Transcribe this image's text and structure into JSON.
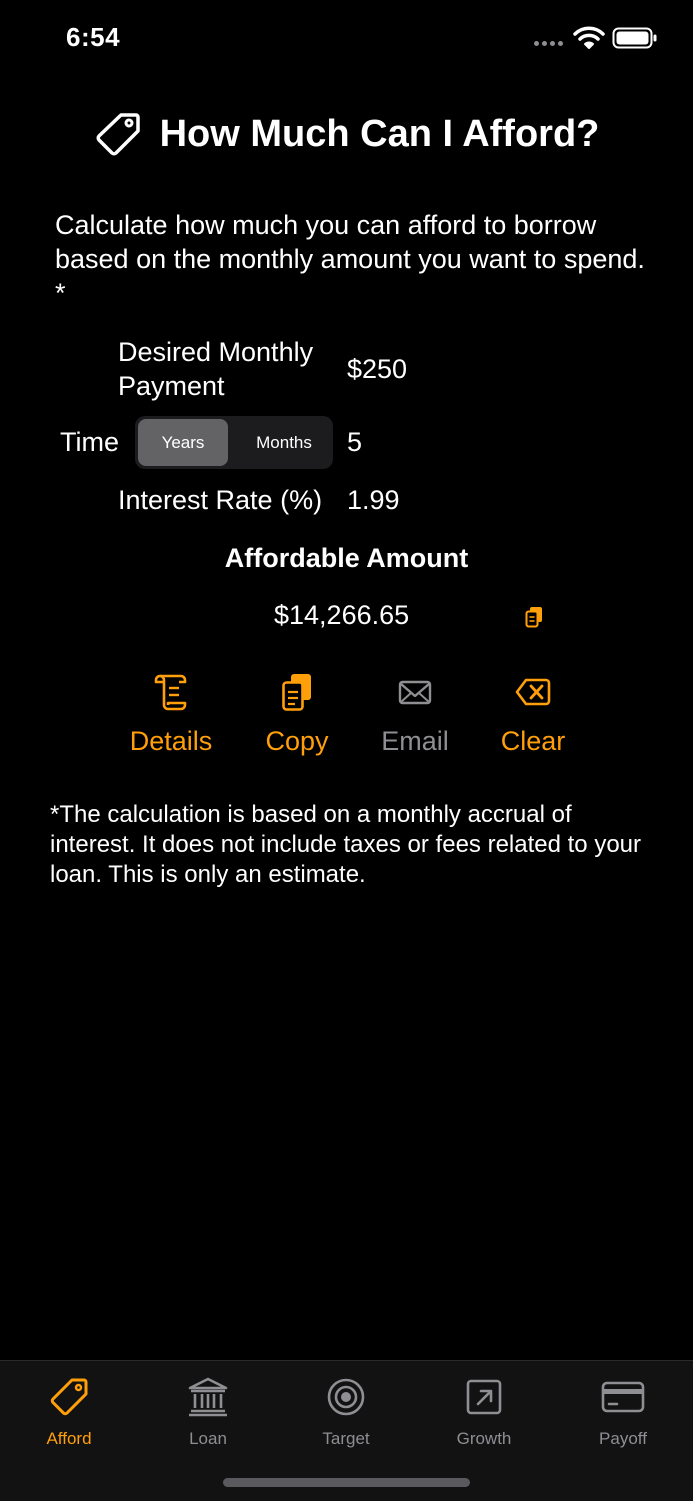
{
  "status": {
    "time": "6:54"
  },
  "header": {
    "title": "How Much Can I Afford?",
    "icon": "tag-icon"
  },
  "intro": "Calculate how much you can afford to borrow based on the monthly amount you want to spend. *",
  "form": {
    "monthly_label_line1": "Desired Monthly",
    "monthly_label_line2": "Payment",
    "monthly_value": "$250",
    "time_label": "Time",
    "time_options": [
      "Years",
      "Months"
    ],
    "time_selected": "Years",
    "time_value": "5",
    "rate_label": "Interest Rate (%)",
    "rate_value": "1.99"
  },
  "result": {
    "title": "Affordable Amount",
    "amount": "$14,266.65"
  },
  "actions": [
    {
      "label": "Details",
      "icon": "scroll-icon"
    },
    {
      "label": "Copy",
      "icon": "copy-icon"
    },
    {
      "label": "Email",
      "icon": "envelope-icon"
    },
    {
      "label": "Clear",
      "icon": "delete-backward-icon"
    }
  ],
  "footnote": "*The calculation is based on a monthly accrual of interest.  It does not include taxes or fees related to your loan.  This is only an estimate.",
  "tabs": [
    {
      "label": "Afford",
      "icon": "tag-icon",
      "active": true
    },
    {
      "label": "Loan",
      "icon": "bank-icon",
      "active": false
    },
    {
      "label": "Target",
      "icon": "target-icon",
      "active": false
    },
    {
      "label": "Growth",
      "icon": "arrow-up-right-square-icon",
      "active": false
    },
    {
      "label": "Payoff",
      "icon": "credit-card-icon",
      "active": false
    }
  ],
  "colors": {
    "accent": "#ff9f0a",
    "inactive": "#8e8e93",
    "background": "#000000"
  }
}
